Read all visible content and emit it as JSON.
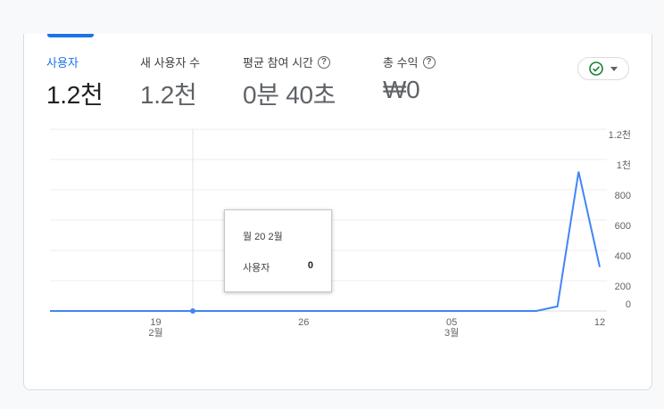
{
  "metrics": [
    {
      "label": "사용자",
      "value": "1.2천"
    },
    {
      "label": "새 사용자 수",
      "value": "1.2천"
    },
    {
      "label": "평균 참여 시간",
      "value": "0분 40초"
    },
    {
      "label": "총 수익",
      "value": "₩0"
    }
  ],
  "colors": {
    "accent": "#1a73e8",
    "line": "#4285f4",
    "check": "#188038"
  },
  "tooltip": {
    "date": "월 20 2월",
    "metric": "사용자",
    "value": "0"
  },
  "chart_data": {
    "type": "line",
    "y_ticks": [
      "0",
      "200",
      "400",
      "600",
      "800",
      "1천",
      "1.2천"
    ],
    "ylim": [
      0,
      1200
    ],
    "x_ticks": [
      {
        "day": "19",
        "month": "2월"
      },
      {
        "day": "26",
        "month": ""
      },
      {
        "day": "05",
        "month": "3월"
      },
      {
        "day": "12",
        "month": ""
      }
    ],
    "series": [
      {
        "x": [
          "2/14",
          "2/15",
          "2/16",
          "2/17",
          "2/18",
          "2/19",
          "2/20",
          "2/21",
          "2/22",
          "2/23",
          "2/24",
          "2/25",
          "2/26",
          "2/27",
          "2/28",
          "3/1",
          "3/2",
          "3/3",
          "3/4",
          "3/5",
          "3/6",
          "3/7",
          "3/8",
          "3/9",
          "3/10",
          "3/11",
          "3/12"
        ],
        "values": [
          0,
          0,
          0,
          0,
          0,
          0,
          0,
          0,
          0,
          0,
          0,
          0,
          0,
          0,
          0,
          0,
          0,
          0,
          0,
          0,
          0,
          0,
          0,
          0,
          30,
          920,
          290
        ]
      }
    ],
    "grid": true
  }
}
